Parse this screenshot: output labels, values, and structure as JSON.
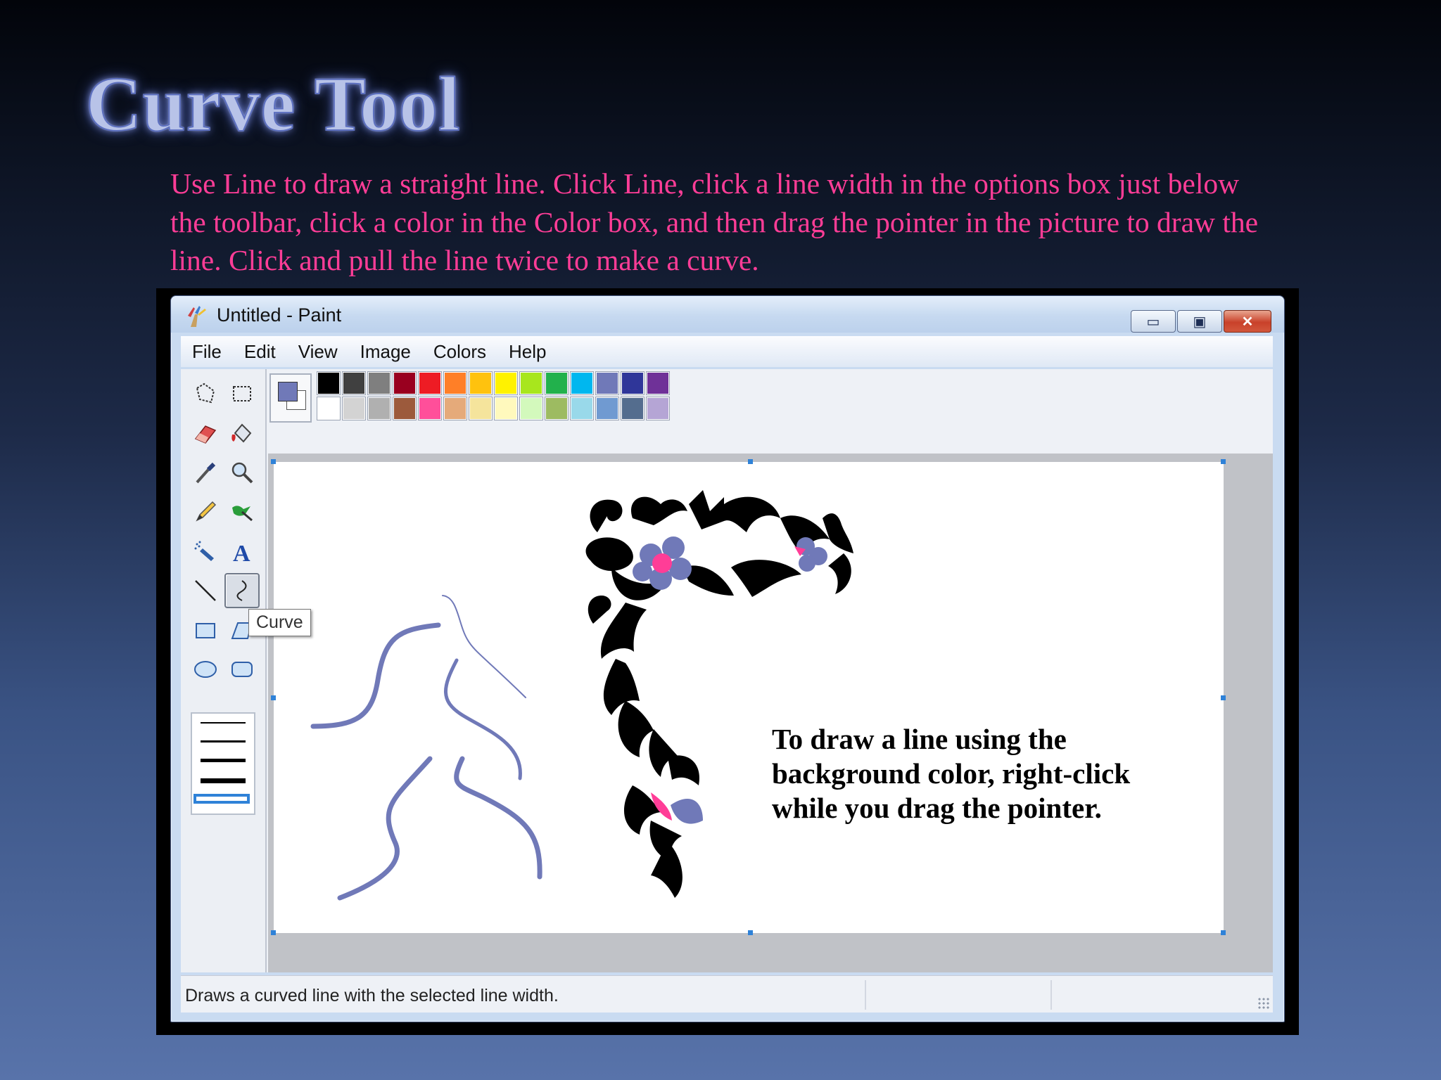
{
  "slide": {
    "title": "Curve Tool",
    "body": "Use Line to draw a straight line. Click Line, click a line width in the options box just below the toolbar, click a color in the Color box, and then drag the pointer in the picture to draw the line. Click and pull the line twice to make a curve."
  },
  "window": {
    "title": "Untitled - Paint",
    "controls": {
      "minimize": "▭",
      "maximize": "▣",
      "close": "✕"
    }
  },
  "menu": [
    "File",
    "Edit",
    "View",
    "Image",
    "Colors",
    "Help"
  ],
  "toolbox": {
    "tools": [
      "free-form-select",
      "select",
      "eraser",
      "fill-with-color",
      "pick-color",
      "magnifier",
      "pencil",
      "brush",
      "airbrush",
      "text",
      "line",
      "curve",
      "rectangle",
      "polygon",
      "ellipse",
      "rounded-rectangle"
    ],
    "selected_tool": "curve",
    "tooltip": "Curve",
    "selected_line_width": 4
  },
  "colors": {
    "foreground": "#7079b8",
    "background": "#ffffff",
    "palette_row1": [
      "#000000",
      "#404040",
      "#7f7f7f",
      "#99001f",
      "#ee1c24",
      "#ff7f27",
      "#ffc20e",
      "#fff200",
      "#a8e61d",
      "#22b14c",
      "#00b7ef",
      "#7079b8",
      "#2f3699",
      "#6f3198"
    ],
    "palette_row2": [
      "#ffffff",
      "#d3d3d3",
      "#b0b0b0",
      "#9c5a3c",
      "#ff4f9a",
      "#e5aa7a",
      "#f5e49c",
      "#fff9bd",
      "#d3f9bc",
      "#9dbb61",
      "#99d9ea",
      "#709ad1",
      "#546d8e",
      "#b5a5d5"
    ],
    "curve_stroke": "#7079b8",
    "accent_pink": "#ff3d97"
  },
  "canvas": {
    "text": "To draw a line using the background color, right-click while you drag the pointer."
  },
  "status": {
    "text": "Draws a curved line with the selected line width."
  }
}
